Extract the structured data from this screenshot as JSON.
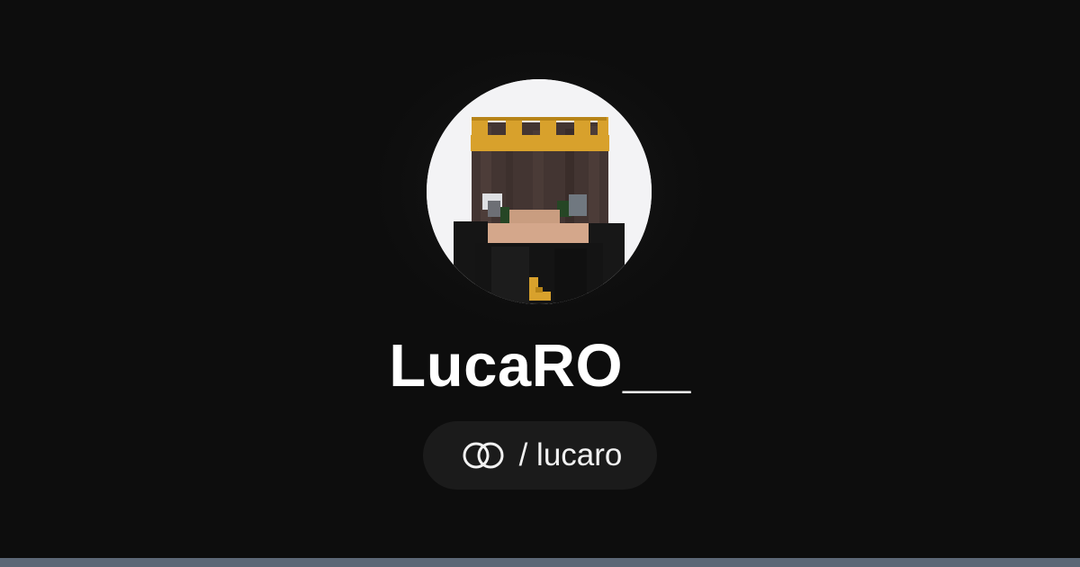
{
  "profile": {
    "display_name": "LucaRO__",
    "handle_separator": "/",
    "handle": "lucaro",
    "handle_text": "/ lucaro",
    "avatar_icon": "minecraft-king-avatar",
    "link_icon": "linked-rings-icon"
  },
  "theme": {
    "background": "#0d0d0d",
    "avatar_background": "#f3f3f5",
    "pill_background": "#1b1b1b",
    "text_color": "#ffffff",
    "bottom_bar": "#5c6776",
    "crown_color": "#d8a12c"
  }
}
